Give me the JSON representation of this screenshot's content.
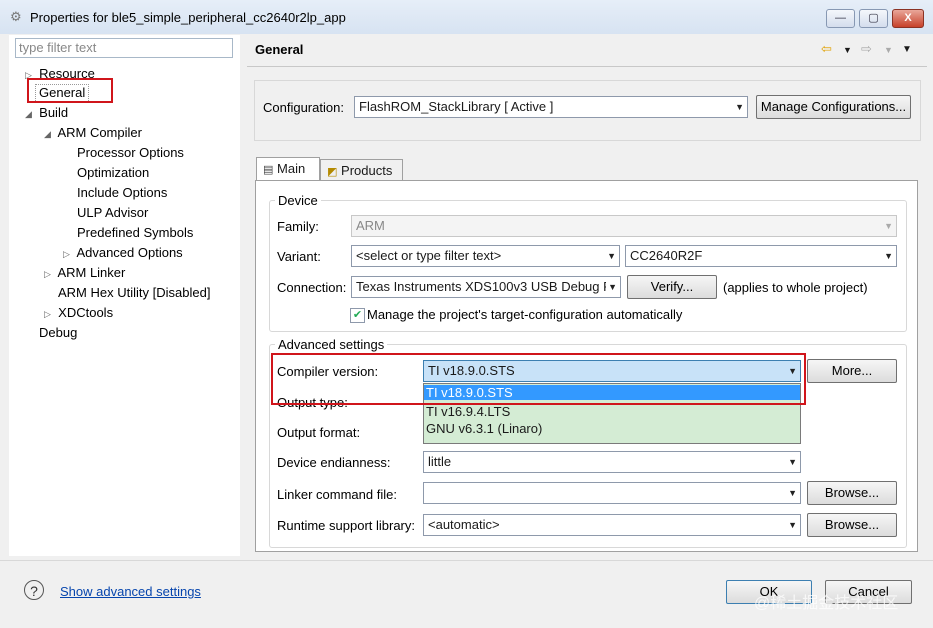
{
  "window": {
    "title": "Properties for ble5_simple_peripheral_cc2640r2lp_app",
    "minimize": "—",
    "maximize": "▢",
    "close": "X"
  },
  "filter": {
    "placeholder": "type filter text"
  },
  "tree": {
    "resource": "Resource",
    "general": "General",
    "build": "Build",
    "arm_compiler": "ARM Compiler",
    "processor_options": "Processor Options",
    "optimization": "Optimization",
    "include_options": "Include Options",
    "ulp_advisor": "ULP Advisor",
    "predefined_symbols": "Predefined Symbols",
    "advanced_options": "Advanced Options",
    "arm_linker": "ARM Linker",
    "arm_hex_utility": "ARM Hex Utility  [Disabled]",
    "xdctools": "XDCtools",
    "debug": "Debug"
  },
  "header": {
    "title": "General"
  },
  "configuration": {
    "label": "Configuration:",
    "value": "FlashROM_StackLibrary  [ Active ]",
    "manage_button": "Manage Configurations..."
  },
  "tabs": {
    "main": "Main",
    "products": "Products"
  },
  "device": {
    "group_label": "Device",
    "family_label": "Family:",
    "family_value": "ARM",
    "variant_label": "Variant:",
    "variant_filter": "<select or type filter text>",
    "variant_value": "CC2640R2F",
    "connection_label": "Connection:",
    "connection_value": "Texas Instruments XDS100v3 USB Debug P",
    "verify_button": "Verify...",
    "applies_note": "(applies to whole project)",
    "manage_checkbox": "Manage the project's target-configuration automatically"
  },
  "advanced": {
    "group_label": "Advanced settings",
    "compiler_label": "Compiler version:",
    "compiler_value": "TI v18.9.0.STS",
    "more_button": "More...",
    "compiler_options": [
      "TI v18.9.0.STS",
      "TI v16.9.4.LTS",
      "GNU v6.3.1 (Linaro)"
    ],
    "output_type_label": "Output type:",
    "output_format_label": "Output format:",
    "endianness_label": "Device endianness:",
    "endianness_value": "little",
    "linker_label": "Linker command file:",
    "linker_value": "",
    "browse_button": "Browse...",
    "runtime_label": "Runtime support library:",
    "runtime_value": "<automatic>"
  },
  "footer": {
    "show_advanced": "Show advanced settings",
    "ok": "OK",
    "cancel": "Cancel",
    "watermark": "@稀土掘金技术社区"
  },
  "colors": {
    "highlight_red": "#d0151b",
    "selection_blue": "#3399ff",
    "dropdown_green": "#d4ecd4",
    "link_blue": "#0645ad"
  }
}
